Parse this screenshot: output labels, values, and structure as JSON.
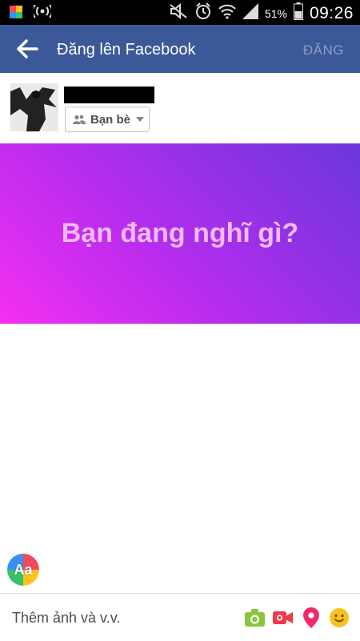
{
  "status_bar": {
    "battery_percent": "51%",
    "time": "09:26"
  },
  "app_bar": {
    "title": "Đăng lên Facebook",
    "post_label": "ĐĂNG"
  },
  "profile": {
    "audience_label": "Bạn bè"
  },
  "composer": {
    "placeholder": "Bạn đang nghĩ gì?",
    "gradient_colors": [
      "#6a37dd",
      "#f52ef2"
    ]
  },
  "font_button": {
    "label": "Aa"
  },
  "bottom_bar": {
    "add_label": "Thêm ảnh và v.v."
  },
  "colors": {
    "header_blue": "#3b5998",
    "photo_green": "#8cc33f",
    "video_red": "#f0384b",
    "location_pink": "#f02a6b",
    "feeling_yellow": "#f7c21b"
  }
}
